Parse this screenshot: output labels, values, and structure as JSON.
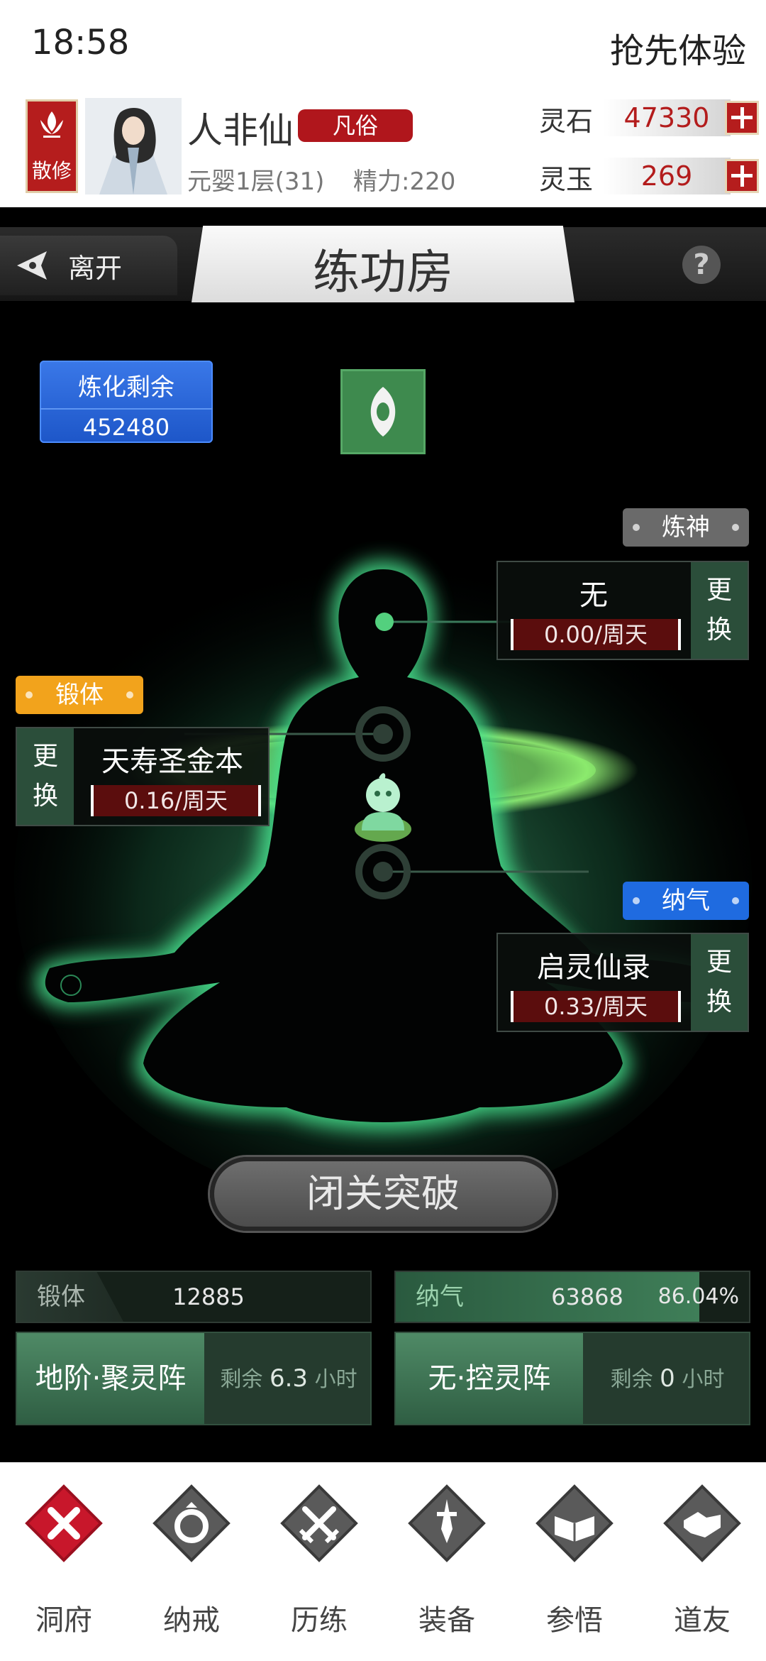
{
  "status_bar": {
    "time": "18:58",
    "action": "抢先体验"
  },
  "player": {
    "sect_badge": "散修",
    "name": "人非仙",
    "rank_tag": "凡俗",
    "realm": "元婴1层(31)",
    "energy": "精力:220"
  },
  "resources": [
    {
      "label": "灵石",
      "value": "47330"
    },
    {
      "label": "灵玉",
      "value": "269"
    }
  ],
  "titlebar": {
    "leave_label": "离开",
    "title": "练功房",
    "help": "?"
  },
  "refine_remaining": {
    "label": "炼化剩余",
    "value": "452480"
  },
  "slots": {
    "shen": {
      "tag": "炼神",
      "name": "无",
      "rate": "0.00/周天",
      "change_top": "更",
      "change_bottom": "换"
    },
    "ti": {
      "tag": "锻体",
      "name": "天寿圣金本",
      "rate": "0.16/周天",
      "change_top": "更",
      "change_bottom": "换"
    },
    "qi": {
      "tag": "纳气",
      "name": "启灵仙录",
      "rate": "0.33/周天",
      "change_top": "更",
      "change_bottom": "换"
    }
  },
  "breakthrough_label": "闭关突破",
  "stats": {
    "ti": {
      "label": "锻体",
      "value": "12885"
    },
    "qi": {
      "label": "纳气",
      "value": "63868",
      "percent": "86.04%",
      "progress_fraction": 0.8604
    }
  },
  "arrays": {
    "left": {
      "name": "地阶·聚灵阵",
      "remain_prefix": "剩余",
      "remain_value": "6.3",
      "remain_unit": "小时"
    },
    "right": {
      "name": "无·控灵阵",
      "remain_prefix": "剩余",
      "remain_value": "0",
      "remain_unit": "小时"
    }
  },
  "bottom_nav": [
    {
      "label": "洞府",
      "icon": "close-x-icon",
      "active": true
    },
    {
      "label": "纳戒",
      "icon": "ring-icon"
    },
    {
      "label": "历练",
      "icon": "crossed-swords-icon"
    },
    {
      "label": "装备",
      "icon": "dagger-icon"
    },
    {
      "label": "参悟",
      "icon": "book-icon"
    },
    {
      "label": "道友",
      "icon": "handshake-icon"
    }
  ],
  "colors": {
    "accent_red": "#b51d1d",
    "glow_green": "#5ee39a",
    "blue_card": "#2a65d8",
    "tag_orange": "#f2a31c",
    "tag_blue": "#1f6be0"
  }
}
